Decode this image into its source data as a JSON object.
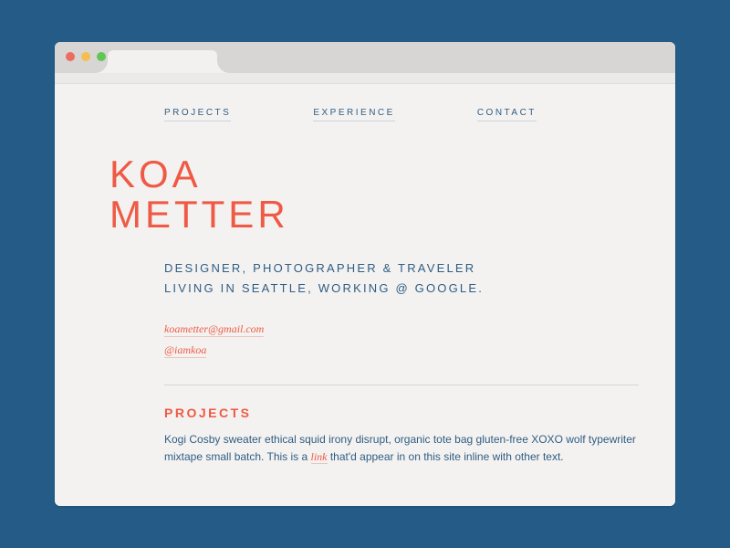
{
  "nav": {
    "items": [
      "PROJECTS",
      "EXPERIENCE",
      "CONTACT"
    ]
  },
  "hero": {
    "name_line1": "KOA",
    "name_line2": "METTER",
    "tagline_line1": "DESIGNER, PHOTOGRAPHER & TRAVELER",
    "tagline_line2": "LIVING IN SEATTLE, WORKING @ GOOGLE."
  },
  "contacts": {
    "email": "koametter@gmail.com",
    "handle": "@iamkoa"
  },
  "section": {
    "title": "PROJECTS",
    "body_before": "Kogi Cosby sweater ethical squid irony disrupt, organic tote bag gluten-free XOXO wolf typewriter mixtape small batch. This is a ",
    "link_text": "link",
    "body_after": " that'd appear in on this site inline with other text."
  },
  "colors": {
    "bg": "#245b87",
    "paper": "#f4f2f0",
    "accent": "#ee5a45",
    "text": "#2e5d85"
  }
}
